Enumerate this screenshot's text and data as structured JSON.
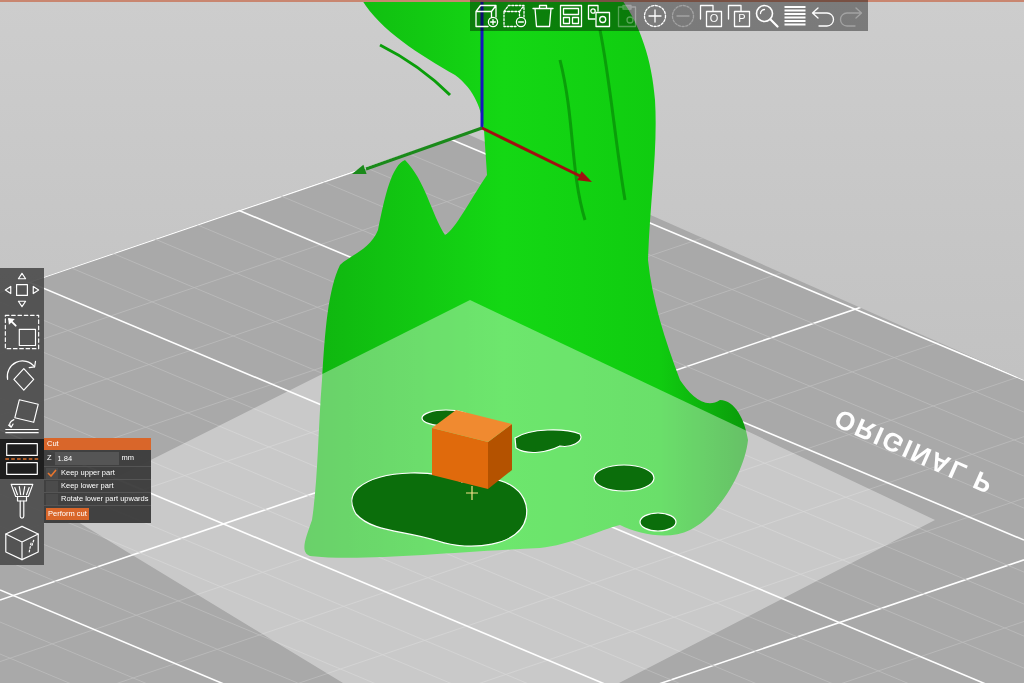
{
  "top_toolbar": {
    "tools": [
      {
        "kind": "add",
        "disabled": false
      },
      {
        "kind": "delete",
        "disabled": false
      },
      {
        "kind": "delete_all",
        "disabled": false
      },
      {
        "kind": "arrange",
        "disabled": false
      },
      {
        "kind": "copy",
        "disabled": false
      },
      {
        "kind": "paste",
        "disabled": true
      },
      {
        "kind": "add_instance",
        "disabled": false
      },
      {
        "kind": "remove_instance",
        "disabled": true
      },
      {
        "kind": "split_objects",
        "label": "O",
        "disabled": false
      },
      {
        "kind": "split_parts",
        "label": "P",
        "disabled": false
      },
      {
        "kind": "search",
        "disabled": false
      },
      {
        "kind": "layers",
        "disabled": false
      },
      {
        "kind": "undo",
        "disabled": false
      },
      {
        "kind": "redo",
        "disabled": true
      }
    ]
  },
  "left_toolbar": {
    "tools": [
      {
        "kind": "move",
        "selected": false
      },
      {
        "kind": "scale",
        "selected": false
      },
      {
        "kind": "rotate",
        "selected": false
      },
      {
        "kind": "place_on_face",
        "selected": false
      },
      {
        "kind": "cut",
        "selected": true
      },
      {
        "kind": "paint",
        "selected": false
      },
      {
        "kind": "cube",
        "selected": false
      }
    ]
  },
  "cut_panel": {
    "title": "Cut",
    "z_label": "Z",
    "z_value": "1.84",
    "unit": "mm",
    "options": [
      {
        "label": "Keep upper part",
        "checked": true
      },
      {
        "label": "Keep lower part",
        "checked": false
      },
      {
        "label": "Rotate lower part upwards",
        "checked": false
      }
    ],
    "button": "Perform cut"
  },
  "bed": {
    "label": "ORIGINAL P"
  }
}
